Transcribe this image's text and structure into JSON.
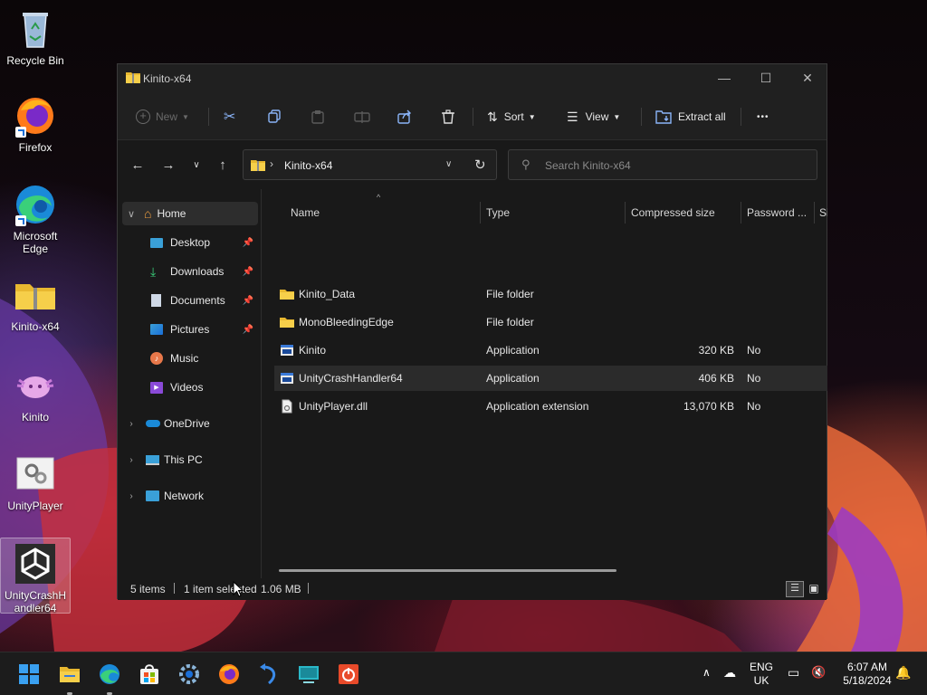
{
  "desktop": {
    "icons": [
      {
        "label": "Recycle Bin"
      },
      {
        "label": "Firefox"
      },
      {
        "label": "Microsoft Edge"
      },
      {
        "label": "Kinito-x64"
      },
      {
        "label": "Kinito"
      },
      {
        "label": "UnityPlayer"
      },
      {
        "label": "UnityCrashHandler64"
      }
    ]
  },
  "window": {
    "title": "Kinito-x64",
    "minimize": "—",
    "maximize": "☐",
    "close": "✕"
  },
  "commandbar": {
    "new_label": "New",
    "sort_label": "Sort",
    "view_label": "View",
    "extract_label": "Extract all",
    "more_label": "•••"
  },
  "address": {
    "path": "Kinito-x64",
    "search_placeholder": "Search Kinito-x64"
  },
  "sidebar": {
    "items": [
      {
        "label": "Home",
        "icon": "home-icon"
      },
      {
        "label": "Desktop",
        "icon": "desktop-folder-icon"
      },
      {
        "label": "Downloads",
        "icon": "download-icon"
      },
      {
        "label": "Documents",
        "icon": "documents-icon"
      },
      {
        "label": "Pictures",
        "icon": "pictures-icon"
      },
      {
        "label": "Music",
        "icon": "music-icon"
      },
      {
        "label": "Videos",
        "icon": "videos-icon"
      },
      {
        "label": "OneDrive",
        "icon": "onedrive-icon"
      },
      {
        "label": "This PC",
        "icon": "this-pc-icon"
      },
      {
        "label": "Network",
        "icon": "network-icon"
      }
    ]
  },
  "files": {
    "columns": [
      "Name",
      "Type",
      "Compressed size",
      "Password ...",
      "Si"
    ],
    "rows": [
      {
        "name": "Kinito_Data",
        "type": "File folder",
        "size": "",
        "password": "",
        "kind": "folder"
      },
      {
        "name": "MonoBleedingEdge",
        "type": "File folder",
        "size": "",
        "password": "",
        "kind": "folder"
      },
      {
        "name": "Kinito",
        "type": "Application",
        "size": "320 KB",
        "password": "No",
        "kind": "app"
      },
      {
        "name": "UnityCrashHandler64",
        "type": "Application",
        "size": "406 KB",
        "password": "No",
        "kind": "app"
      },
      {
        "name": "UnityPlayer.dll",
        "type": "Application extension",
        "size": "13,070 KB",
        "password": "No",
        "kind": "dll"
      }
    ]
  },
  "status": {
    "count": "5 items",
    "selected": "1 item selected",
    "size": "1.06 MB"
  },
  "tray": {
    "lang1": "ENG",
    "lang2": "UK",
    "time": "6:07 AM",
    "date": "5/18/2024"
  },
  "colors": {
    "accent": "#0078d4",
    "folder": "#f1c232",
    "window_bg": "#191919"
  }
}
